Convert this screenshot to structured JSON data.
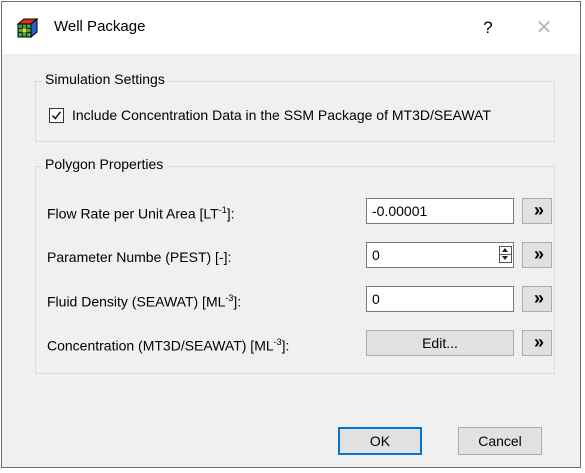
{
  "window": {
    "title": "Well Package",
    "help_label": "?",
    "close_label": "✕"
  },
  "simulation_settings": {
    "title": "Simulation Settings",
    "include_concentration": {
      "label": "Include Concentration Data in the SSM Package of MT3D/SEAWAT",
      "checked": true
    }
  },
  "polygon_properties": {
    "title": "Polygon Properties",
    "flow_rate": {
      "label_main": "Flow Rate per Unit Area [LT",
      "label_sup": "-1",
      "label_end": "]:",
      "value": "-0.00001"
    },
    "parameter_number": {
      "label": "Parameter Numbe (PEST) [-]:",
      "value": "0"
    },
    "fluid_density": {
      "label_main": "Fluid Density (SEAWAT) [ML",
      "label_sup": "-3",
      "label_end": "]:",
      "value": "0"
    },
    "concentration": {
      "label_main": "Concentration (MT3D/SEAWAT) [ML",
      "label_sup": "-3",
      "label_end": "]:",
      "button_label": "Edit..."
    },
    "expand_button_label": "»"
  },
  "buttons": {
    "ok": "OK",
    "cancel": "Cancel"
  },
  "colors": {
    "default_button_border": "#0078d7",
    "dialog_background": "#f0f0f0"
  }
}
